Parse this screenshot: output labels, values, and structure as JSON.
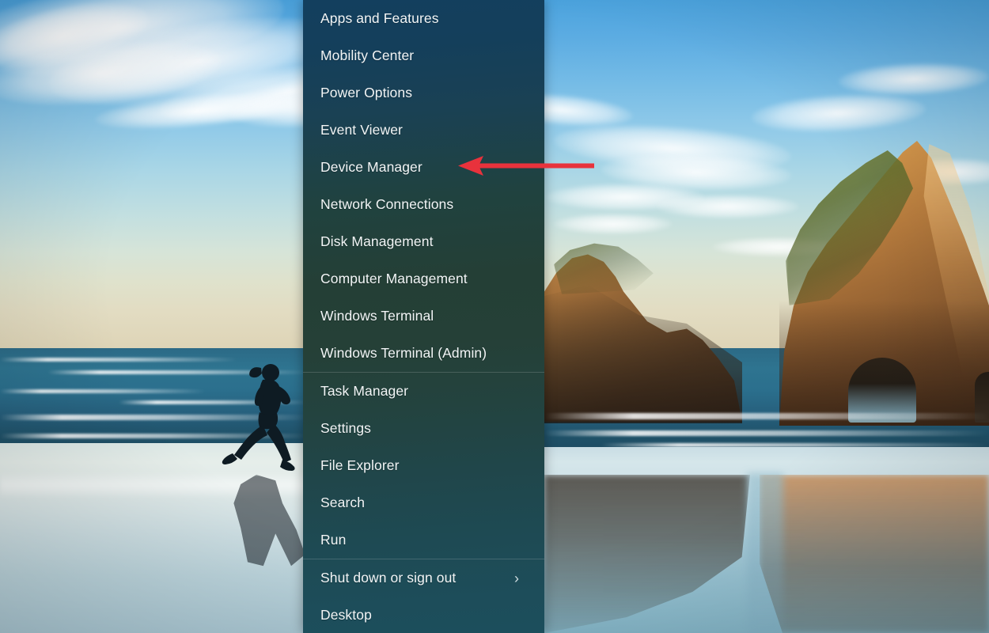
{
  "desktop": {
    "wallpaper_name": "wharariki-beach-wallpaper",
    "description": "Beach at sunset with Archway Islands rock formations and a running person silhouette"
  },
  "winx_menu": {
    "name": "Windows Quick Link menu",
    "groups": [
      {
        "items": [
          {
            "label": "Apps and Features",
            "has_submenu": false
          },
          {
            "label": "Mobility Center",
            "has_submenu": false
          },
          {
            "label": "Power Options",
            "has_submenu": false
          },
          {
            "label": "Event Viewer",
            "has_submenu": false
          },
          {
            "label": "Device Manager",
            "has_submenu": false
          },
          {
            "label": "Network Connections",
            "has_submenu": false
          },
          {
            "label": "Disk Management",
            "has_submenu": false
          },
          {
            "label": "Computer Management",
            "has_submenu": false
          },
          {
            "label": "Windows Terminal",
            "has_submenu": false
          },
          {
            "label": "Windows Terminal (Admin)",
            "has_submenu": false
          }
        ]
      },
      {
        "items": [
          {
            "label": "Task Manager",
            "has_submenu": false
          },
          {
            "label": "Settings",
            "has_submenu": false
          },
          {
            "label": "File Explorer",
            "has_submenu": false
          },
          {
            "label": "Search",
            "has_submenu": false
          },
          {
            "label": "Run",
            "has_submenu": false
          }
        ]
      },
      {
        "items": [
          {
            "label": "Shut down or sign out",
            "has_submenu": true,
            "submenu_icon": "chevron-right-icon",
            "submenu_glyph": "›"
          },
          {
            "label": "Desktop",
            "has_submenu": false
          }
        ]
      }
    ],
    "colors": {
      "background_top": "#133f5e",
      "background_middle": "#24403a",
      "background_bottom": "#1c4e5c",
      "text": "#f2f5f6",
      "separator": "rgba(255,255,255,0.16)"
    }
  },
  "annotation": {
    "type": "arrow",
    "direction": "left",
    "color": "#e8323c",
    "points_to": "Device Manager"
  }
}
